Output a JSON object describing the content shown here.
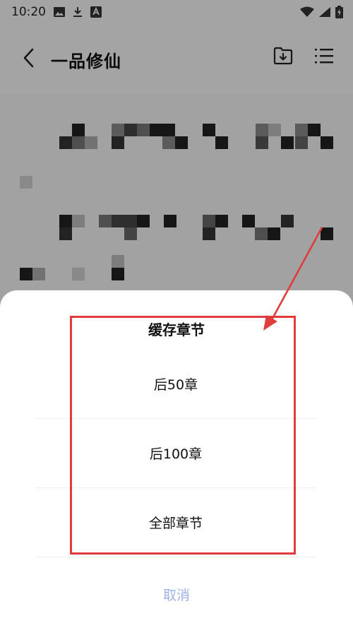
{
  "status_bar": {
    "time": "10:20",
    "left_icons": [
      "image-icon",
      "download-icon",
      "font-icon"
    ],
    "right_icons": [
      "wifi-icon",
      "signal-icon",
      "battery-charging-icon"
    ]
  },
  "nav": {
    "title": "一品修仙",
    "back_icon": "chevron-left-icon",
    "actions": [
      "download-folder-icon",
      "menu-list-icon"
    ]
  },
  "sheet": {
    "title": "缓存章节",
    "options": [
      {
        "label": "后50章"
      },
      {
        "label": "后100章"
      },
      {
        "label": "全部章节"
      }
    ],
    "cancel_label": "取消"
  },
  "colors": {
    "accent_cancel": "#9bb3e6",
    "annotation": "#e03c3c",
    "overlay": "rgba(0,0,0,0.33)"
  }
}
